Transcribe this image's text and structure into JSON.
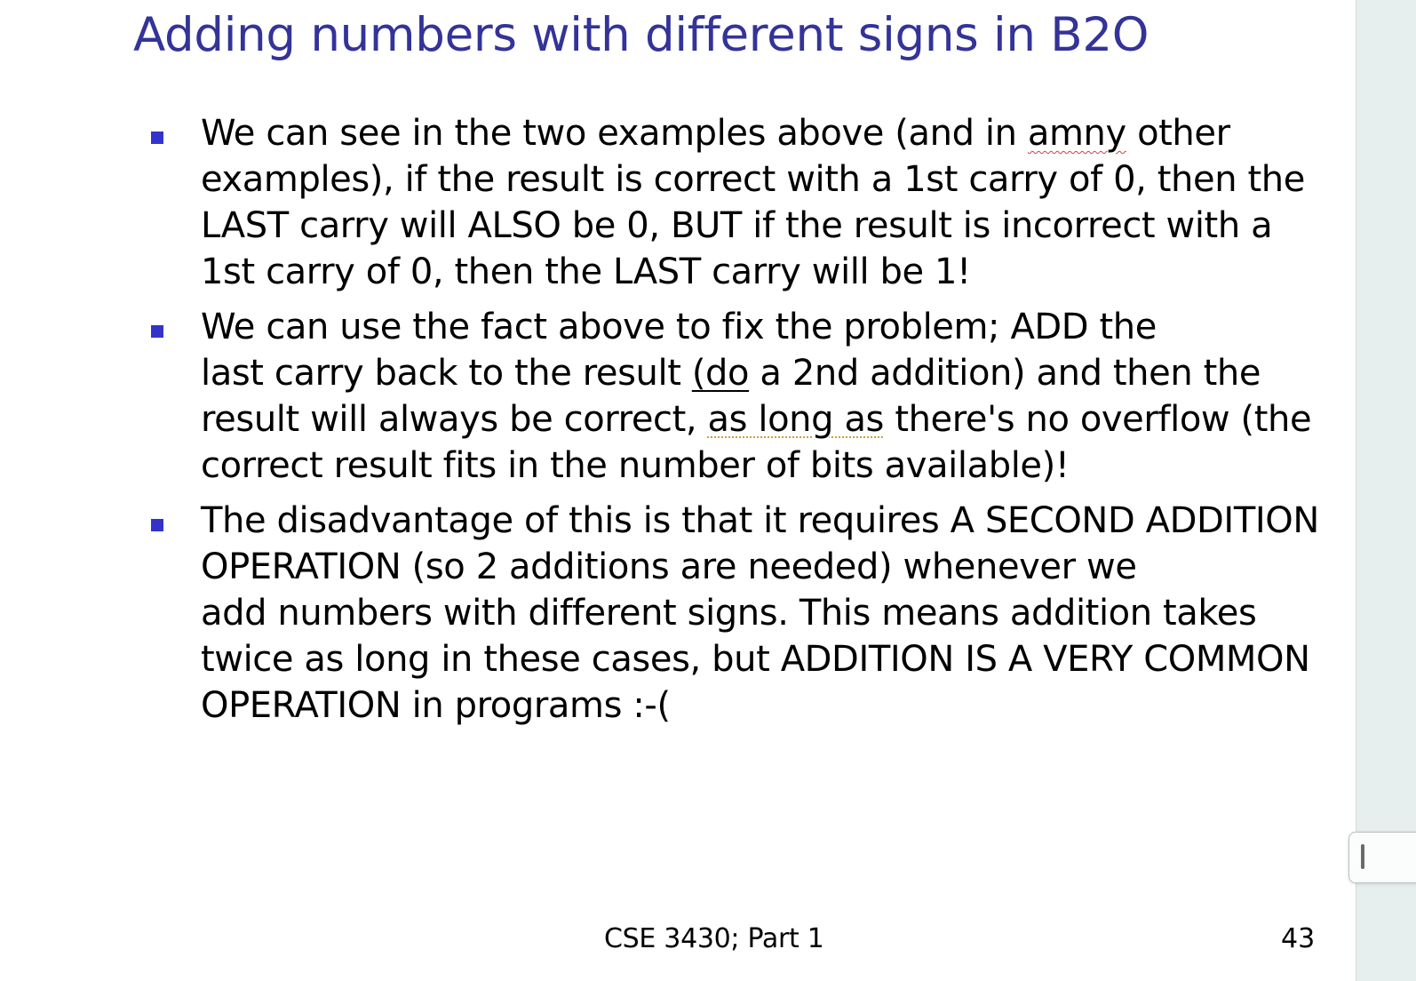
{
  "slide": {
    "title": "Adding numbers with different signs in B2O",
    "bullets": [
      {
        "lines": [
          [
            "We can see in the two examples above (and in ",
            "amny",
            " other"
          ],
          "examples), if the result is correct with a 1st carry of 0, then the",
          "LAST carry will ALSO be 0, BUT if the result is incorrect with a",
          "1st carry of 0, then the LAST carry will be 1!"
        ]
      },
      {
        "lines": [
          "We can use the fact above to fix the problem; ADD the",
          [
            "last carry back to the result ",
            "(do",
            " a 2nd addition) and then the"
          ],
          [
            "result will always be correct, ",
            "as long as",
            " there's no overflow (the"
          ],
          "correct result fits in the number of bits available)!"
        ]
      },
      {
        "lines": [
          "The disadvantage of this is that it requires A SECOND ADDITION",
          "OPERATION (so 2 additions are needed) whenever we",
          "add numbers with different signs. This means addition takes",
          "twice as long in these cases, but ADDITION IS A VERY COMMON",
          "OPERATION in programs :-("
        ]
      }
    ],
    "footer": {
      "course": "CSE 3430; Part 1",
      "page_number": "43"
    }
  },
  "colors": {
    "title": "#333399",
    "bullet_marker": "#3333cc",
    "body_text": "#000000",
    "side_panel": "#e7eeee"
  },
  "icons": {
    "bullet": "square-bullet-icon",
    "splitter": "splitter-grip-icon"
  }
}
